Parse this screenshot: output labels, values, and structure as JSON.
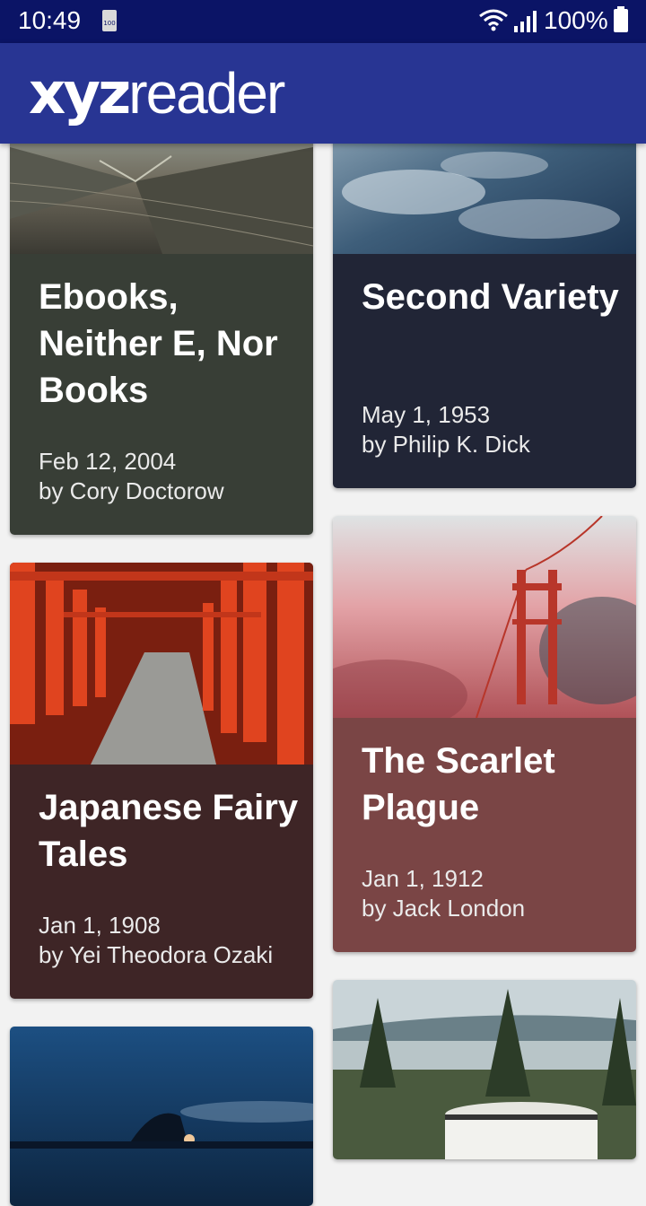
{
  "status_bar": {
    "time": "10:49",
    "battery_icon_label": "100",
    "battery_percent": "100%"
  },
  "app_bar": {
    "logo_bold": "xyz",
    "logo_light": "reader"
  },
  "articles": [
    {
      "title": "Ebooks, Neither E, Nor Books",
      "date": "Feb 12, 2004",
      "author": "by Cory Doctorow",
      "color": "#383e36"
    },
    {
      "title": "Second Variety",
      "date": "May 1, 1953",
      "author": "by Philip K. Dick",
      "color": "#212536"
    },
    {
      "title": "Japanese Fairy Tales",
      "date": "Jan 1, 1908",
      "author": "by Yei Theodora Ozaki",
      "color": "#3e2526"
    },
    {
      "title": "The Scarlet Plague",
      "date": "Jan 1, 1912",
      "author": "by Jack London",
      "color": "#7a4545"
    },
    {
      "title": "",
      "date": "",
      "author": "",
      "color": "#1b3a5c"
    },
    {
      "title": "",
      "date": "",
      "author": "",
      "color": "#3d5a3a"
    }
  ]
}
